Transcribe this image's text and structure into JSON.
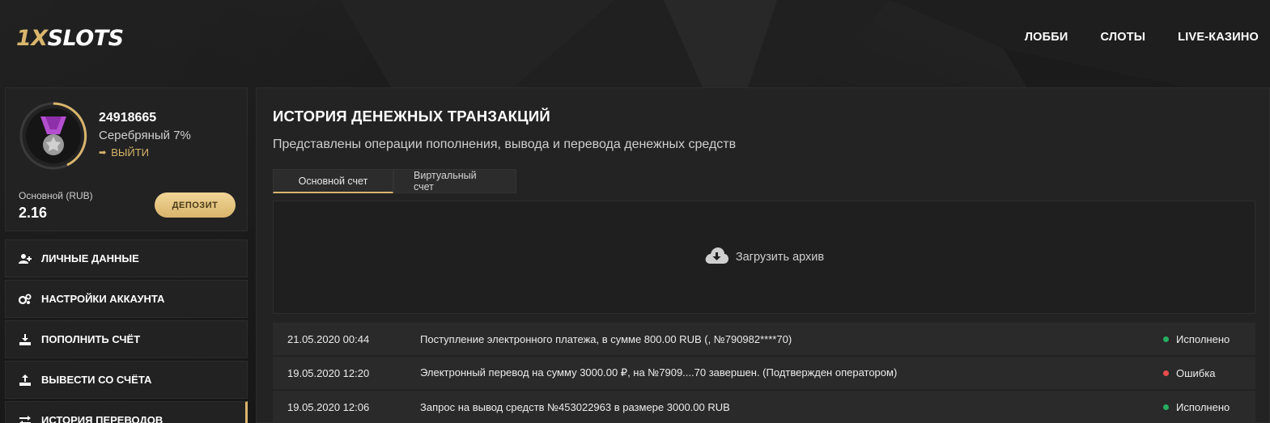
{
  "header": {
    "logo_part1": "1X",
    "logo_part2": "SLOTS",
    "nav": [
      "ЛОББИ",
      "СЛОТЫ",
      "LIVE-КАЗИНО"
    ]
  },
  "profile": {
    "user_id": "24918665",
    "level": "Серебряный 7%",
    "logout_label": "ВЫЙТИ",
    "account_label": "Основной (RUB)",
    "balance": "2.16",
    "deposit_label": "ДЕПОЗИТ"
  },
  "menu": [
    {
      "label": "ЛИЧНЫЕ ДАННЫЕ",
      "icon": "add-user-icon"
    },
    {
      "label": "НАСТРОЙКИ АККАУНТА",
      "icon": "gears-icon"
    },
    {
      "label": "ПОПОЛНИТЬ СЧЁТ",
      "icon": "download-icon"
    },
    {
      "label": "ВЫВЕСТИ СО СЧЁТА",
      "icon": "upload-icon"
    },
    {
      "label": "ИСТОРИЯ ПЕРЕВОДОВ",
      "icon": "transfer-icon"
    }
  ],
  "main": {
    "title": "ИСТОРИЯ ДЕНЕЖНЫХ ТРАНЗАКЦИЙ",
    "subtitle": "Представлены операции пополнения, вывода и перевода денежных средств",
    "tabs": [
      {
        "label": "Основной счет",
        "active": true
      },
      {
        "label": "Виртуальный счет",
        "active": false
      }
    ],
    "archive_label": "Загрузить архив",
    "transactions": [
      {
        "date": "21.05.2020 00:44",
        "description": "Поступление электронного платежа, в сумме 800.00 RUB (, №790982****70)",
        "status": "Исполнено",
        "status_color": "#27ae60"
      },
      {
        "date": "19.05.2020 12:20",
        "description": "Электронный перевод на сумму 3000.00 ₽, на №7909....70 завершен. (Подтвержден оператором)",
        "status": "Ошибка",
        "status_color": "#e74c4c"
      },
      {
        "date": "19.05.2020 12:06",
        "description": "Запрос на вывод средств №453022963 в размере 3000.00 RUB",
        "status": "Исполнено",
        "status_color": "#27ae60"
      }
    ]
  },
  "colors": {
    "accent": "#d9b56c",
    "success": "#27ae60",
    "error": "#e74c4c",
    "medal": "#a53fc2"
  }
}
